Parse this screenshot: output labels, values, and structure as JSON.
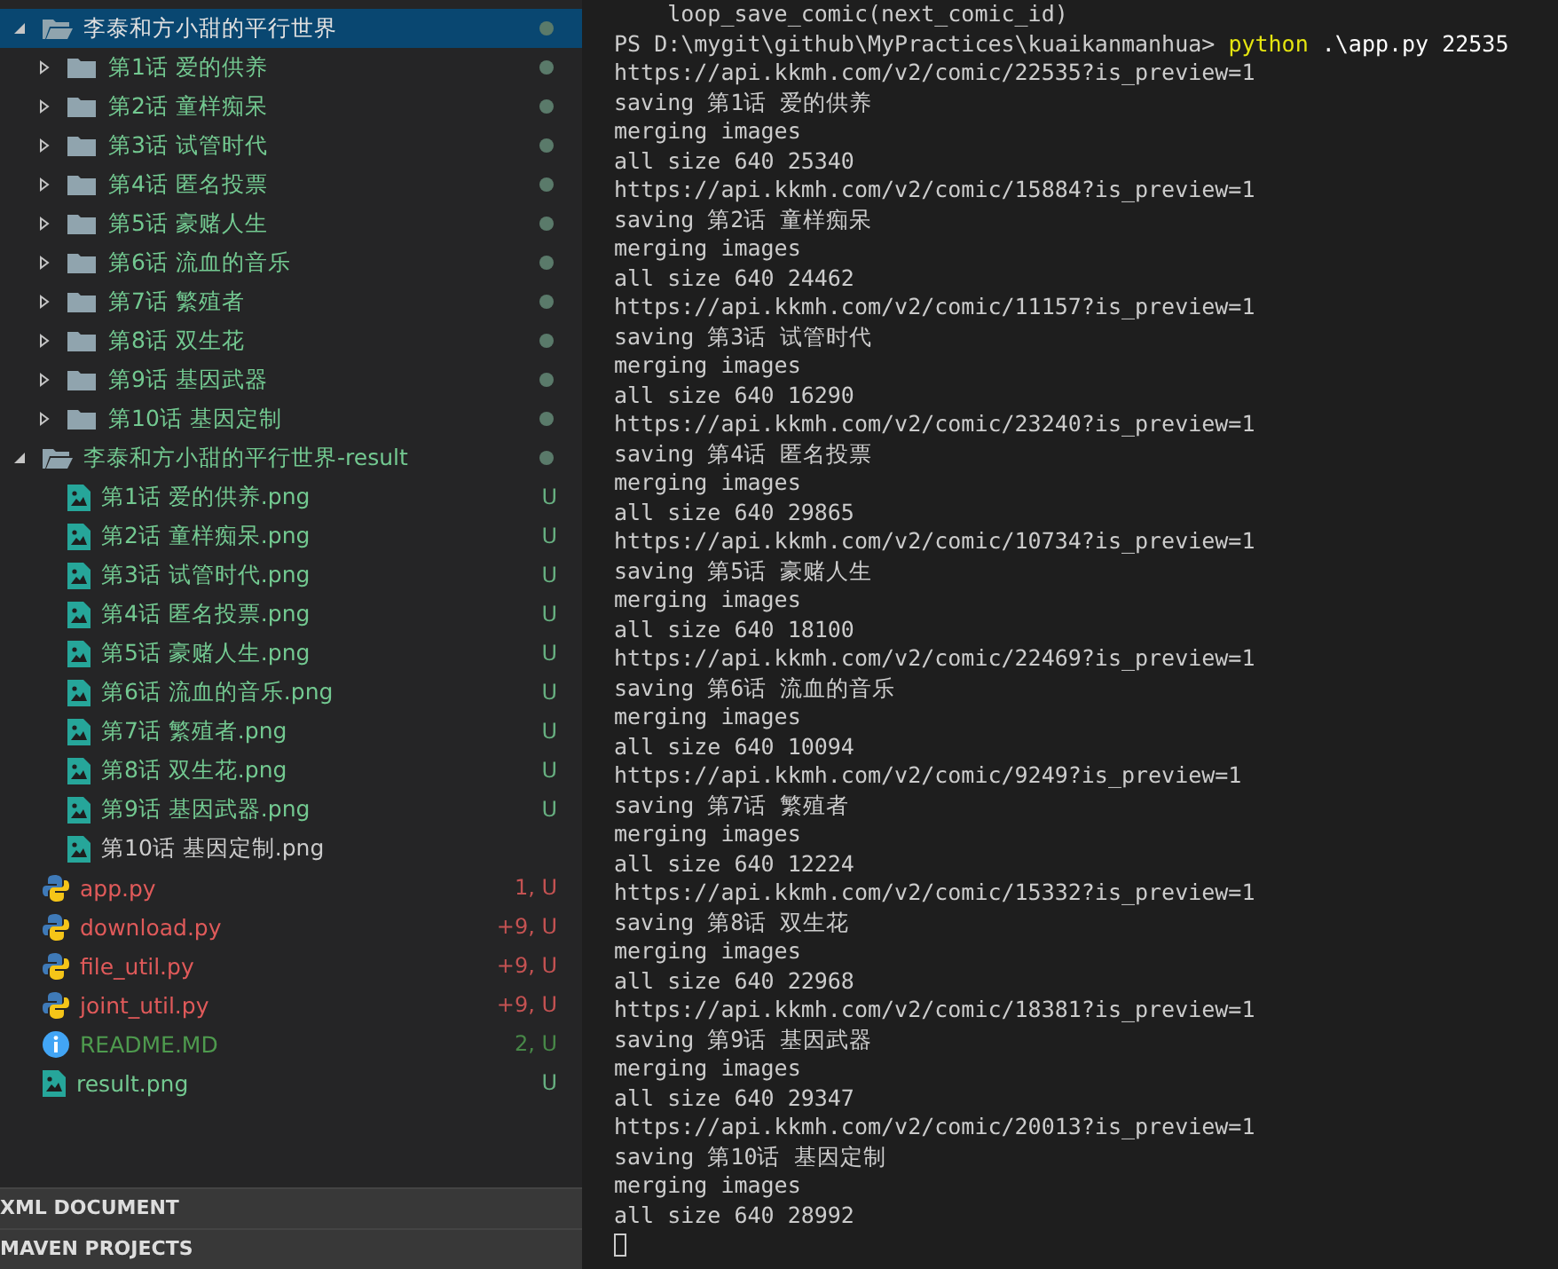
{
  "explorer": {
    "tree": [
      {
        "name": "李泰和方小甜的平行世界",
        "kind": "folder",
        "expanded": true,
        "selected": true,
        "modified_dot": true,
        "color": "#e0e0e0",
        "children": [
          {
            "name": "第1话 爱的供养",
            "kind": "folder",
            "expanded": false,
            "selected": false,
            "modified_dot": true,
            "color": "#73c991"
          },
          {
            "name": "第2话 童样痴呆",
            "kind": "folder",
            "expanded": false,
            "selected": false,
            "modified_dot": true,
            "color": "#73c991"
          },
          {
            "name": "第3话 试管时代",
            "kind": "folder",
            "expanded": false,
            "selected": false,
            "modified_dot": true,
            "color": "#73c991"
          },
          {
            "name": "第4话 匿名投票",
            "kind": "folder",
            "expanded": false,
            "selected": false,
            "modified_dot": true,
            "color": "#73c991"
          },
          {
            "name": "第5话 豪赌人生",
            "kind": "folder",
            "expanded": false,
            "selected": false,
            "modified_dot": true,
            "color": "#73c991"
          },
          {
            "name": "第6话 流血的音乐",
            "kind": "folder",
            "expanded": false,
            "selected": false,
            "modified_dot": true,
            "color": "#73c991"
          },
          {
            "name": "第7话 繁殖者",
            "kind": "folder",
            "expanded": false,
            "selected": false,
            "modified_dot": true,
            "color": "#73c991"
          },
          {
            "name": "第8话 双生花",
            "kind": "folder",
            "expanded": false,
            "selected": false,
            "modified_dot": true,
            "color": "#73c991"
          },
          {
            "name": "第9话 基因武器",
            "kind": "folder",
            "expanded": false,
            "selected": false,
            "modified_dot": true,
            "color": "#73c991"
          },
          {
            "name": "第10话 基因定制",
            "kind": "folder",
            "expanded": false,
            "selected": false,
            "modified_dot": true,
            "color": "#73c991"
          }
        ]
      },
      {
        "name": "李泰和方小甜的平行世界-result",
        "kind": "folder",
        "expanded": true,
        "selected": false,
        "modified_dot": true,
        "color": "#73c991",
        "children": [
          {
            "name": "第1话 爱的供养.png",
            "kind": "image",
            "selected": false,
            "status": "U",
            "color": "#73c991"
          },
          {
            "name": "第2话 童样痴呆.png",
            "kind": "image",
            "selected": false,
            "status": "U",
            "color": "#73c991"
          },
          {
            "name": "第3话 试管时代.png",
            "kind": "image",
            "selected": false,
            "status": "U",
            "color": "#73c991"
          },
          {
            "name": "第4话 匿名投票.png",
            "kind": "image",
            "selected": false,
            "status": "U",
            "color": "#73c991"
          },
          {
            "name": "第5话 豪赌人生.png",
            "kind": "image",
            "selected": false,
            "status": "U",
            "color": "#73c991"
          },
          {
            "name": "第6话 流血的音乐.png",
            "kind": "image",
            "selected": false,
            "status": "U",
            "color": "#73c991"
          },
          {
            "name": "第7话 繁殖者.png",
            "kind": "image",
            "selected": false,
            "status": "U",
            "color": "#73c991"
          },
          {
            "name": "第8话 双生花.png",
            "kind": "image",
            "selected": false,
            "status": "U",
            "color": "#73c991"
          },
          {
            "name": "第9话 基因武器.png",
            "kind": "image",
            "selected": false,
            "status": "U",
            "color": "#73c991"
          },
          {
            "name": "第10话 基因定制.png",
            "kind": "image",
            "selected": false,
            "color": "#cccccc"
          }
        ]
      },
      {
        "name": "app.py",
        "kind": "python",
        "selected": false,
        "status": "1, U",
        "color": "#e05a5a"
      },
      {
        "name": "download.py",
        "kind": "python",
        "selected": false,
        "status": "+9, U",
        "color": "#e05a5a"
      },
      {
        "name": "file_util.py",
        "kind": "python",
        "selected": false,
        "status": "+9, U",
        "color": "#e05a5a"
      },
      {
        "name": "joint_util.py",
        "kind": "python",
        "selected": false,
        "status": "+9, U",
        "color": "#e05a5a"
      },
      {
        "name": "README.MD",
        "kind": "info",
        "selected": false,
        "status": "2, U",
        "color": "#4e9a4e"
      },
      {
        "name": "result.png",
        "kind": "image",
        "selected": false,
        "status": "U",
        "color": "#73c991"
      }
    ]
  },
  "sections": [
    "XML DOCUMENT",
    "MAVEN PROJECTS"
  ],
  "terminal": {
    "lines": [
      {
        "kind": "output",
        "text": "    loop_save_comic(next_comic_id)"
      },
      {
        "kind": "prompt",
        "prompt": "PS D:\\mygit\\github\\MyPractices\\kuaikanmanhua> ",
        "command": "python",
        "args": " .\\app.py 22535"
      },
      {
        "kind": "output",
        "text": "https://api.kkmh.com/v2/comic/22535?is_preview=1"
      },
      {
        "kind": "output",
        "text": "saving 第1话 爱的供养"
      },
      {
        "kind": "output",
        "text": "merging images"
      },
      {
        "kind": "output",
        "text": "all size 640 25340"
      },
      {
        "kind": "output",
        "text": "https://api.kkmh.com/v2/comic/15884?is_preview=1"
      },
      {
        "kind": "output",
        "text": "saving 第2话 童样痴呆"
      },
      {
        "kind": "output",
        "text": "merging images"
      },
      {
        "kind": "output",
        "text": "all size 640 24462"
      },
      {
        "kind": "output",
        "text": "https://api.kkmh.com/v2/comic/11157?is_preview=1"
      },
      {
        "kind": "output",
        "text": "saving 第3话 试管时代"
      },
      {
        "kind": "output",
        "text": "merging images"
      },
      {
        "kind": "output",
        "text": "all size 640 16290"
      },
      {
        "kind": "output",
        "text": "https://api.kkmh.com/v2/comic/23240?is_preview=1"
      },
      {
        "kind": "output",
        "text": "saving 第4话 匿名投票"
      },
      {
        "kind": "output",
        "text": "merging images"
      },
      {
        "kind": "output",
        "text": "all size 640 29865"
      },
      {
        "kind": "output",
        "text": "https://api.kkmh.com/v2/comic/10734?is_preview=1"
      },
      {
        "kind": "output",
        "text": "saving 第5话 豪赌人生"
      },
      {
        "kind": "output",
        "text": "merging images"
      },
      {
        "kind": "output",
        "text": "all size 640 18100"
      },
      {
        "kind": "output",
        "text": "https://api.kkmh.com/v2/comic/22469?is_preview=1"
      },
      {
        "kind": "output",
        "text": "saving 第6话 流血的音乐"
      },
      {
        "kind": "output",
        "text": "merging images"
      },
      {
        "kind": "output",
        "text": "all size 640 10094"
      },
      {
        "kind": "output",
        "text": "https://api.kkmh.com/v2/comic/9249?is_preview=1"
      },
      {
        "kind": "output",
        "text": "saving 第7话 繁殖者"
      },
      {
        "kind": "output",
        "text": "merging images"
      },
      {
        "kind": "output",
        "text": "all size 640 12224"
      },
      {
        "kind": "output",
        "text": "https://api.kkmh.com/v2/comic/15332?is_preview=1"
      },
      {
        "kind": "output",
        "text": "saving 第8话 双生花"
      },
      {
        "kind": "output",
        "text": "merging images"
      },
      {
        "kind": "output",
        "text": "all size 640 22968"
      },
      {
        "kind": "output",
        "text": "https://api.kkmh.com/v2/comic/18381?is_preview=1"
      },
      {
        "kind": "output",
        "text": "saving 第9话 基因武器"
      },
      {
        "kind": "output",
        "text": "merging images"
      },
      {
        "kind": "output",
        "text": "all size 640 29347"
      },
      {
        "kind": "output",
        "text": "https://api.kkmh.com/v2/comic/20013?is_preview=1"
      },
      {
        "kind": "output",
        "text": "saving 第10话 基因定制"
      },
      {
        "kind": "output",
        "text": "merging images"
      },
      {
        "kind": "output",
        "text": "all size 640 28992"
      },
      {
        "kind": "cursor"
      }
    ]
  }
}
